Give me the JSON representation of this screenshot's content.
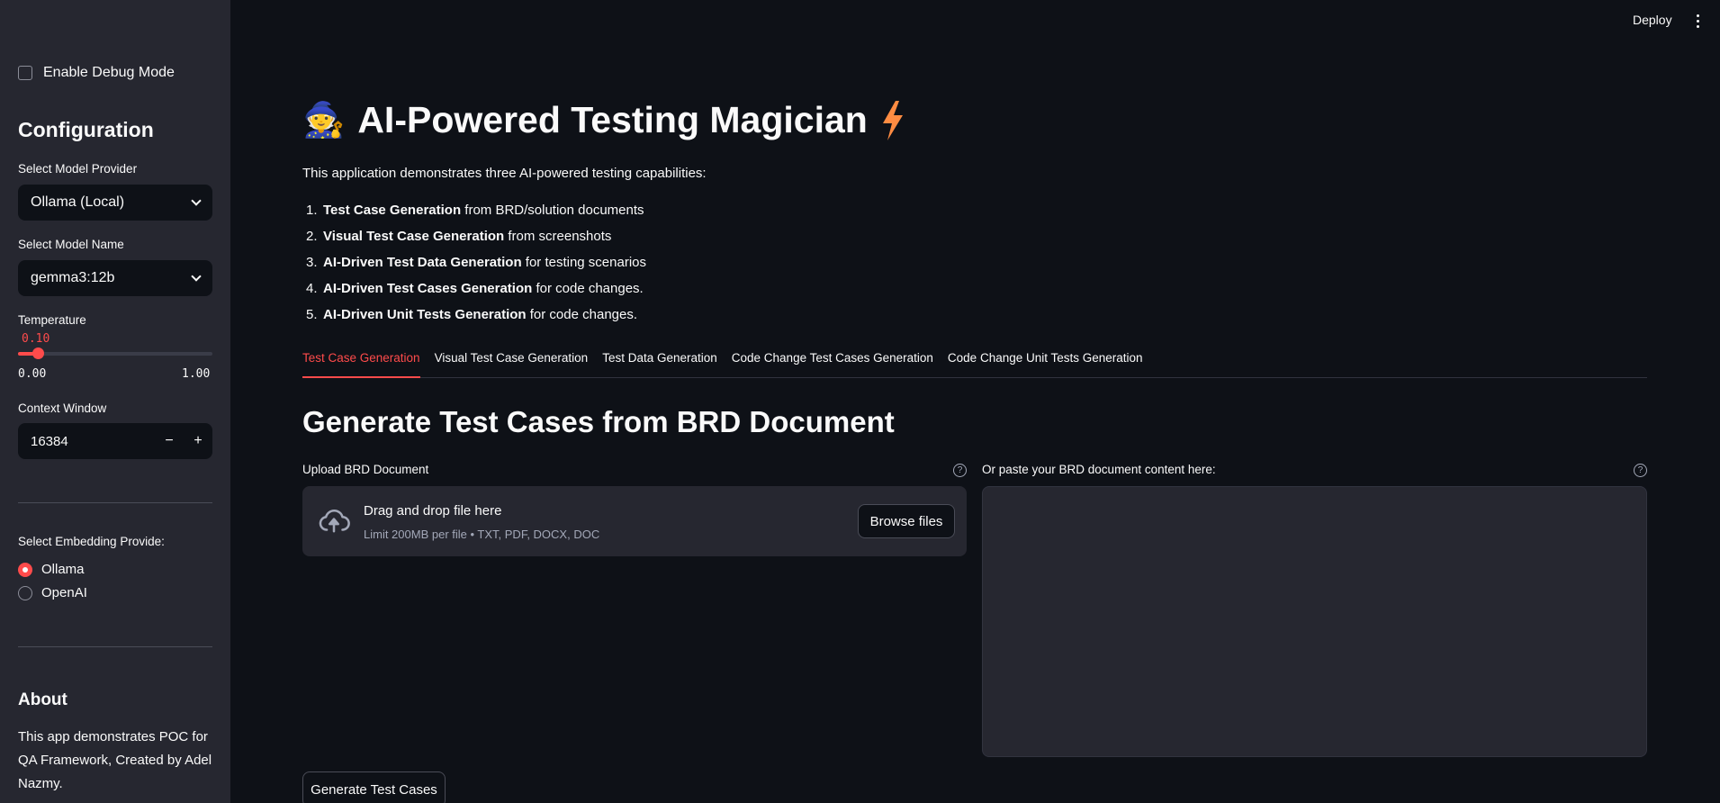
{
  "topbar": {
    "deploy_label": "Deploy"
  },
  "sidebar": {
    "debug_checkbox": {
      "label": "Enable Debug Mode",
      "checked": false
    },
    "config_heading": "Configuration",
    "model_provider": {
      "label": "Select Model Provider",
      "value": "Ollama (Local)"
    },
    "model_name": {
      "label": "Select Model Name",
      "value": "gemma3:12b"
    },
    "temperature": {
      "label": "Temperature",
      "value": "0.10",
      "min": "0.00",
      "max": "1.00",
      "fraction": 0.1
    },
    "context_window": {
      "label": "Context Window",
      "value": "16384",
      "minus": "−",
      "plus": "+"
    },
    "embedding": {
      "label": "Select Embedding Provide:",
      "options": [
        "Ollama",
        "OpenAI"
      ],
      "selected": "Ollama"
    },
    "about_heading": "About",
    "about_text": "This app demonstrates POC for QA Framework, Created by Adel Nazmy."
  },
  "main": {
    "title_icon": "🧙",
    "title": "AI-Powered Testing Magician",
    "title_icon_right": "lightning-icon",
    "intro": "This application demonstrates three AI-powered testing capabilities:",
    "features": [
      {
        "num": "1.",
        "bold": "Test Case Generation",
        "rest": " from BRD/solution documents"
      },
      {
        "num": "2.",
        "bold": "Visual Test Case Generation",
        "rest": " from screenshots"
      },
      {
        "num": "3.",
        "bold": "AI-Driven Test Data Generation",
        "rest": " for testing scenarios"
      },
      {
        "num": "4.",
        "bold": "AI-Driven Test Cases Generation",
        "rest": " for code changes."
      },
      {
        "num": "5.",
        "bold": "AI-Driven Unit Tests Generation",
        "rest": " for code changes."
      }
    ],
    "tabs": [
      "Test Case Generation",
      "Visual Test Case Generation",
      "Test Data Generation",
      "Code Change Test Cases Generation",
      "Code Change Unit Tests Generation"
    ],
    "active_tab": 0,
    "section_title": "Generate Test Cases from BRD Document",
    "upload": {
      "label": "Upload BRD Document",
      "dnd_title": "Drag and drop file here",
      "dnd_sub": "Limit 200MB per file • TXT, PDF, DOCX, DOC",
      "browse_label": "Browse files"
    },
    "paste": {
      "label": "Or paste your BRD document content here:",
      "value": ""
    },
    "help_glyph": "?",
    "generate_label": "Generate Test Cases"
  },
  "colors": {
    "accent": "#ff4b4b",
    "background": "#0e1117",
    "sidebar": "#262730"
  }
}
